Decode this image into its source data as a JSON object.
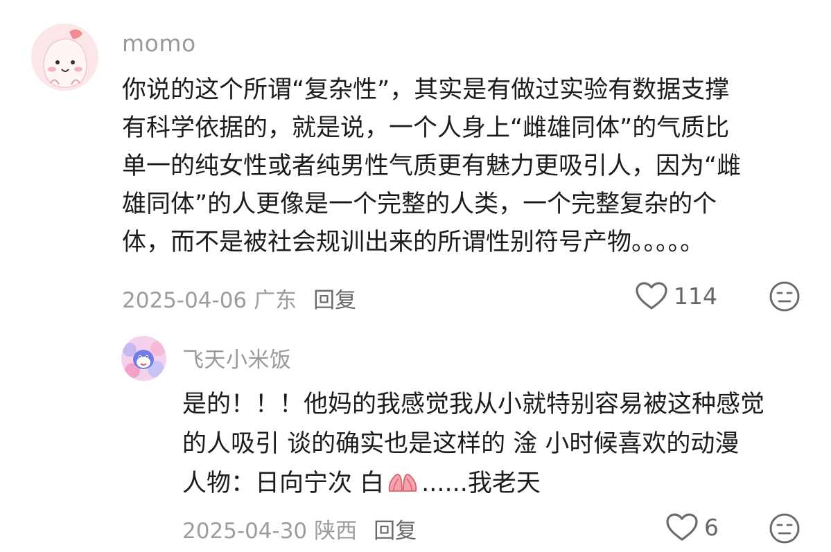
{
  "comment": {
    "username": "momo",
    "lines": [
      "你说的这个所谓“复杂性”，其实是有做过实验有数据支撑",
      "有科学依据的，就是说，一个人身上“雌雄同体”的气质比",
      "单一的纯女性或者纯男性气质更有魅力更吸引人，因为“雌",
      "雄同体”的人更像是一个完整的人类，一个完整复杂的个",
      "体，而不是被社会规训出来的所谓性别符号产物。。。。。"
    ],
    "date": "2025-04-06",
    "location": "广东",
    "reply_label": "回复",
    "likes": "114"
  },
  "reply": {
    "username": "飞天小米饭",
    "lines": [
      "是的！！！他妈的我感觉我从小就特别容易被这种感觉",
      "的人吸引 谈的确实也是这样的 淦 小时候喜欢的动漫"
    ],
    "line3_start": "人物：日向宁次  白",
    "line3_end": "......我老天",
    "date": "2025-04-30",
    "location": "陕西",
    "reply_label": "回复",
    "likes": "6"
  },
  "icons": {
    "like": "heart-outline-icon",
    "dislike": "flat-face-icon",
    "emoji": "praying-hands-emoji"
  },
  "colors": {
    "meta_gray": "#9c9c9c",
    "text": "#1c1c1c"
  }
}
